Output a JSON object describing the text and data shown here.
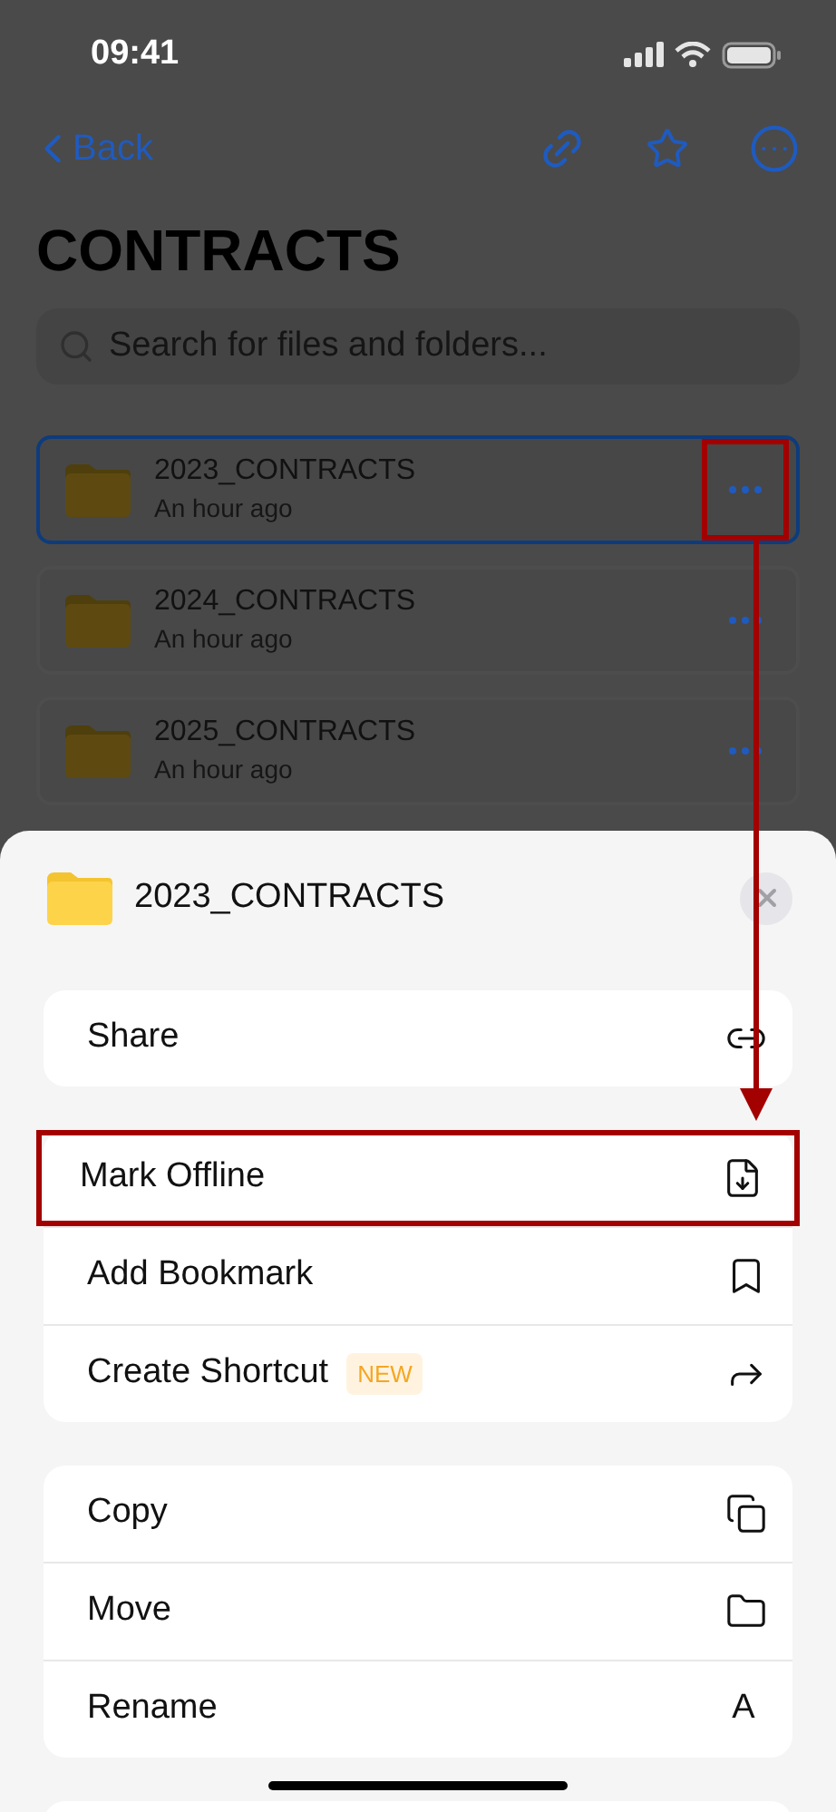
{
  "status_bar": {
    "time": "09:41"
  },
  "nav": {
    "back": "Back"
  },
  "title": "CONTRACTS",
  "search": {
    "placeholder": "Search for files and folders..."
  },
  "rows": [
    {
      "name": "2023_CONTRACTS",
      "time": "An hour ago",
      "selected": true,
      "annotated": true
    },
    {
      "name": "2024_CONTRACTS",
      "time": "An hour ago",
      "selected": false,
      "annotated": false
    },
    {
      "name": "2025_CONTRACTS",
      "time": "An hour ago",
      "selected": false,
      "annotated": false
    }
  ],
  "sheet": {
    "title": "2023_CONTRACTS",
    "groups": [
      {
        "items": [
          {
            "label": "Share",
            "annotated": false
          }
        ]
      },
      {
        "items": [
          {
            "label": "Mark Offline",
            "annotated": true
          },
          {
            "label": "Add Bookmark",
            "annotated": false
          },
          {
            "label": "Create Shortcut",
            "badge": "NEW",
            "annotated": false
          }
        ]
      },
      {
        "items": [
          {
            "label": "Copy",
            "annotated": false
          },
          {
            "label": "Move",
            "annotated": false
          },
          {
            "label": "Rename",
            "glyph": "A",
            "annotated": false
          }
        ]
      }
    ]
  }
}
